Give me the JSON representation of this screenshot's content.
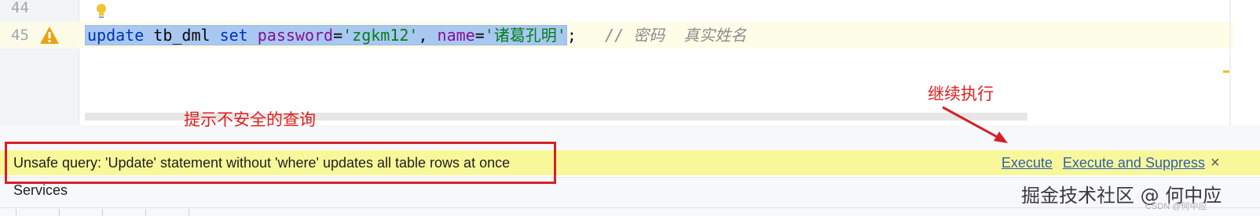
{
  "editor": {
    "lines": [
      {
        "number": "44"
      },
      {
        "number": "45"
      }
    ],
    "code": {
      "kw_update": "update",
      "table": " tb_dml ",
      "kw_set": "set",
      "sp1": " ",
      "col_password": "password",
      "eq1": "=",
      "str_password": "'zgkm12'",
      "comma": ", ",
      "col_name": "name",
      "eq2": "=",
      "str_name": "'诸葛孔明'",
      "semicolon": ";",
      "comment_slashes": "   // ",
      "comment_text": "密码  真实姓名"
    }
  },
  "annotations": {
    "left_note": "提示不安全的查询",
    "right_note": "继续执行"
  },
  "banner": {
    "message": "Unsafe query: 'Update' statement without 'where' updates all table rows at once",
    "execute_label": "Execute",
    "execute_suppress_label": "Execute and Suppress",
    "close_glyph": "×"
  },
  "services": {
    "label": "Services"
  },
  "watermark": {
    "text": "掘金技术社区 @ 何中应",
    "sub": "CSDN @何中应"
  },
  "colors": {
    "banner_bg": "#f8f89a",
    "annotation_red": "#e02020",
    "link_blue": "#2f5fb0",
    "selection": "#a8c8f2"
  }
}
